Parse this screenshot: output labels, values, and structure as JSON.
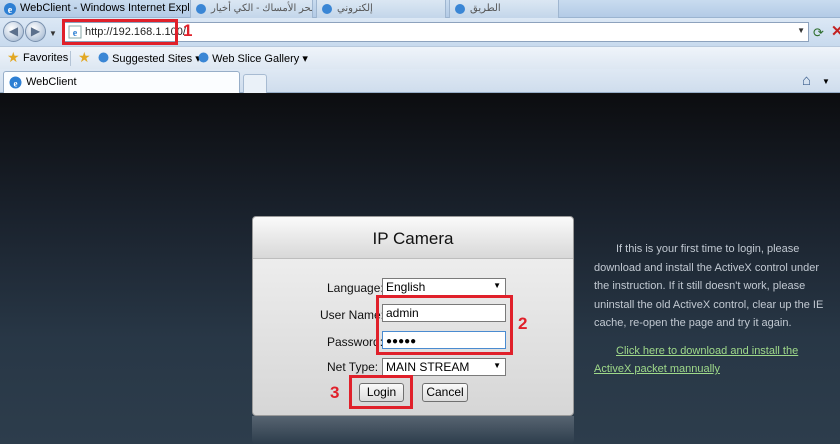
{
  "window": {
    "title": "WebClient - Windows Internet Explorer",
    "background_tabs": [
      "يبحر الأمساك - الكي أخيار",
      "إلكتروني",
      "الطريق"
    ]
  },
  "address_bar": {
    "url": "http://192.168.1.100/"
  },
  "favorites_bar": {
    "favorites_label": "Favorites",
    "suggested_sites_label": "Suggested Sites",
    "web_slice_gallery_label": "Web Slice Gallery"
  },
  "tabs": {
    "active_label": "WebClient"
  },
  "login": {
    "title": "IP Camera",
    "language_label": "Language:",
    "language_value": "English",
    "username_label": "User Name:",
    "username_value": "admin",
    "password_label": "Password:",
    "password_value": "●●●●●",
    "nettype_label": "Net  Type:",
    "nettype_value": "MAIN STREAM",
    "login_button": "Login",
    "cancel_button": "Cancel"
  },
  "info": {
    "text": "If this is your first time to login, please download and install the ActiveX control under the instruction. If it still doesn't work, please uninstall the old ActiveX control, clear up the IE cache, re-open the page and try it again.",
    "link_line1": "Click here to download and install the",
    "link_line2": "ActiveX packet mannually"
  },
  "annotations": {
    "step1": "1",
    "step2": "2",
    "step3": "3",
    "color": "#e0202a"
  }
}
